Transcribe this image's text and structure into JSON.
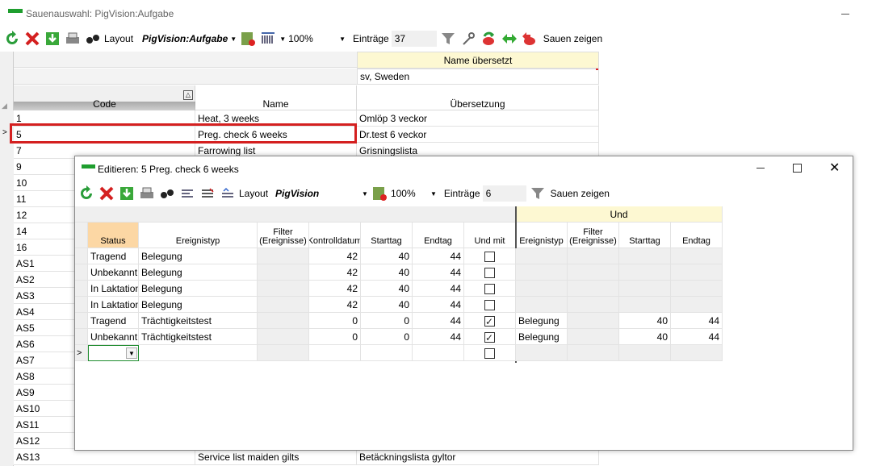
{
  "main": {
    "title": "Sauenauswahl: PigVision:Aufgabe",
    "toolbar": {
      "layout_label": "Layout",
      "layout_value": "PigVision:Aufgabe",
      "zoom": "100%",
      "entries_label": "Einträge",
      "entries_value": "37",
      "show_label": "Sauen zeigen"
    },
    "group_header": "Name übersetzt",
    "lang_value": "sv, Sweden",
    "columns": [
      "Code",
      "Name",
      "Übersetzung"
    ],
    "rows": [
      {
        "code": "1",
        "name": "Heat, 3 weeks",
        "trans": "Omlöp 3 veckor"
      },
      {
        "code": "5",
        "name": "Preg. check 6 weeks",
        "trans": "Dr.test 6 veckor"
      },
      {
        "code": "7",
        "name": "Farrowing list",
        "trans": "Grisningslista"
      },
      {
        "code": "9",
        "name": "",
        "trans": ""
      },
      {
        "code": "10",
        "name": "",
        "trans": ""
      },
      {
        "code": "11",
        "name": "",
        "trans": ""
      },
      {
        "code": "12",
        "name": "",
        "trans": ""
      },
      {
        "code": "14",
        "name": "",
        "trans": ""
      },
      {
        "code": "16",
        "name": "",
        "trans": ""
      },
      {
        "code": "AS1",
        "name": "",
        "trans": ""
      },
      {
        "code": "AS2",
        "name": "",
        "trans": ""
      },
      {
        "code": "AS3",
        "name": "",
        "trans": ""
      },
      {
        "code": "AS4",
        "name": "",
        "trans": ""
      },
      {
        "code": "AS5",
        "name": "",
        "trans": ""
      },
      {
        "code": "AS6",
        "name": "",
        "trans": ""
      },
      {
        "code": "AS7",
        "name": "",
        "trans": ""
      },
      {
        "code": "AS8",
        "name": "",
        "trans": ""
      },
      {
        "code": "AS9",
        "name": "",
        "trans": ""
      },
      {
        "code": "AS10",
        "name": "",
        "trans": ""
      },
      {
        "code": "AS11",
        "name": "",
        "trans": ""
      },
      {
        "code": "AS12",
        "name": "",
        "trans": ""
      },
      {
        "code": "AS13",
        "name": "Service list maiden gilts",
        "trans": "Betäckningslista gyltor"
      }
    ]
  },
  "edit": {
    "title": "Editieren: 5 Preg. check 6 weeks",
    "toolbar": {
      "layout_label": "Layout",
      "layout_value": "PigVision",
      "zoom": "100%",
      "entries_label": "Einträge",
      "entries_value": "6",
      "show_label": "Sauen zeigen"
    },
    "und_header": "Und",
    "columns": [
      "Status",
      "Ereignistyp",
      "Filter (Ereignisse)",
      "Kontrolldatum",
      "Starttag",
      "Endtag",
      "Und mit",
      "Ereignistyp",
      "Filter (Ereignisse)",
      "Starttag",
      "Endtag"
    ],
    "rows": [
      {
        "status": "Tragend",
        "typ": "Belegung",
        "filter": "",
        "kd": "42",
        "start": "40",
        "end": "44",
        "und": false,
        "typ2": "",
        "filter2": "",
        "start2": "",
        "end2": ""
      },
      {
        "status": "Unbekannt",
        "typ": "Belegung",
        "filter": "",
        "kd": "42",
        "start": "40",
        "end": "44",
        "und": false,
        "typ2": "",
        "filter2": "",
        "start2": "",
        "end2": ""
      },
      {
        "status": "In Laktation",
        "typ": "Belegung",
        "filter": "",
        "kd": "42",
        "start": "40",
        "end": "44",
        "und": false,
        "typ2": "",
        "filter2": "",
        "start2": "",
        "end2": ""
      },
      {
        "status": "In Laktation",
        "typ": "Belegung",
        "filter": "",
        "kd": "42",
        "start": "40",
        "end": "44",
        "und": false,
        "typ2": "",
        "filter2": "",
        "start2": "",
        "end2": ""
      },
      {
        "status": "Tragend",
        "typ": "Trächtigkeitstest",
        "filter": "",
        "kd": "0",
        "start": "0",
        "end": "44",
        "und": true,
        "typ2": "Belegung",
        "filter2": "",
        "start2": "40",
        "end2": "44"
      },
      {
        "status": "Unbekannt",
        "typ": "Trächtigkeitstest",
        "filter": "",
        "kd": "0",
        "start": "0",
        "end": "44",
        "und": true,
        "typ2": "Belegung",
        "filter2": "",
        "start2": "40",
        "end2": "44"
      }
    ]
  }
}
